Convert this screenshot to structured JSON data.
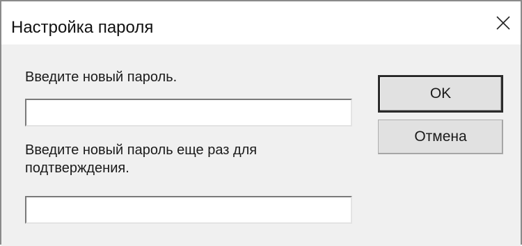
{
  "window": {
    "title": "Настройка пароля",
    "close_icon": "close-icon"
  },
  "form": {
    "new_password_label": "Введите новый пароль.",
    "new_password_value": "",
    "confirm_password_label": "Введите новый пароль еще раз для подтверждения.",
    "confirm_password_value": ""
  },
  "buttons": {
    "ok_label": "OK",
    "cancel_label": "Отмена"
  },
  "colors": {
    "titlebar_bg": "#ffffff",
    "dialog_bg": "#f0f0f0",
    "button_bg": "#e1e1e1",
    "default_button_border": "#2b2b2b"
  }
}
